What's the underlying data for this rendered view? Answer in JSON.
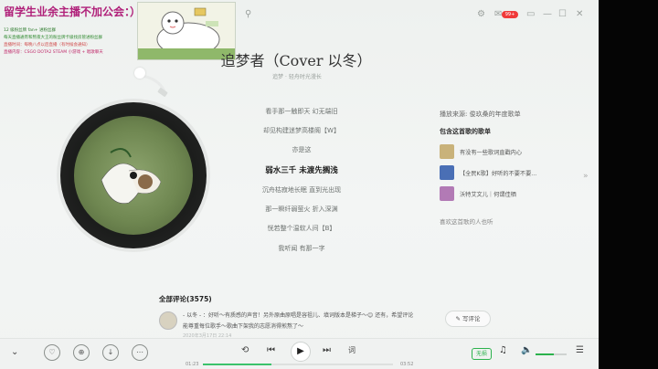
{
  "overlay": {
    "title": "留学生业余主播不加公会：）",
    "lines": [
      {
        "text": "12 级粉丝牌 fan+ 进粉丝群",
        "color": "#2a7a2a"
      },
      {
        "text": "每天直播通宵和熬夜大王的粉丝牌卡级找房管进粉丝群",
        "color": "#2f8a2f"
      },
      {
        "text": "直播时间：每晚八点以后直播（有时候会通知）",
        "color": "#d04a4a"
      },
      {
        "text": "直播内容：CSGO DOTA2 STEAM 小游戏 + 唱歌聊天",
        "color": "#c02a6a"
      }
    ]
  },
  "window": {
    "mail_badge": "99+"
  },
  "song": {
    "title": "追梦者（Cover 以冬）",
    "subtitle": "追梦 · 轻舟时光漫长"
  },
  "lyrics": [
    {
      "text": "看手那一触即天 幻无端旧",
      "active": false
    },
    {
      "text": "却见构建迷梦高楼阁【W】",
      "active": false
    },
    {
      "text": "亦是这",
      "active": false
    },
    {
      "text": "弱水三千 未渡先搁浅",
      "active": true
    },
    {
      "text": "沉舟枯寂地长眠 直到光出现",
      "active": false
    },
    {
      "text": "那一瞬纤弱萤火 折入深渊",
      "active": false
    },
    {
      "text": "恍若整个温软人间【B】",
      "active": false
    },
    {
      "text": "我听闻 有那一字",
      "active": false
    }
  ],
  "right_panel": {
    "source_label": "播放来源: 俊玖桑的年度歌单",
    "contains_label": "包含这首歌的歌单",
    "playlists": [
      {
        "name": "有没有一些歌词直戳内心",
        "color": "#c9b27a"
      },
      {
        "name": "【全民K歌】好听的不要不要...",
        "color": "#4a6fb5"
      },
      {
        "name": "沃特艾文儿｜何谓佳栖",
        "color": "#b27ab5"
      }
    ],
    "also_like": "喜欢这首歌的人也听"
  },
  "comments": {
    "title": "全部评论(3575)",
    "line1": "- 以冬 - ：好听～有质感的声音！另外原曲原唱是容祖儿、填词版本是梯子～😊 还有，希望评论",
    "line2": "能尊重每位歌手～歌曲下架我的志愿消得煎熬了～",
    "meta": "2020年3月17日 22:14",
    "write_label": "写评论"
  },
  "player": {
    "time_current": "01:23",
    "time_total": "03:52",
    "progress": 0.36,
    "quality": "无损",
    "volume": 0.6,
    "lyric_btn": "词"
  },
  "colors": {
    "accent": "#2bb24c",
    "badge": "#f03a3a"
  }
}
